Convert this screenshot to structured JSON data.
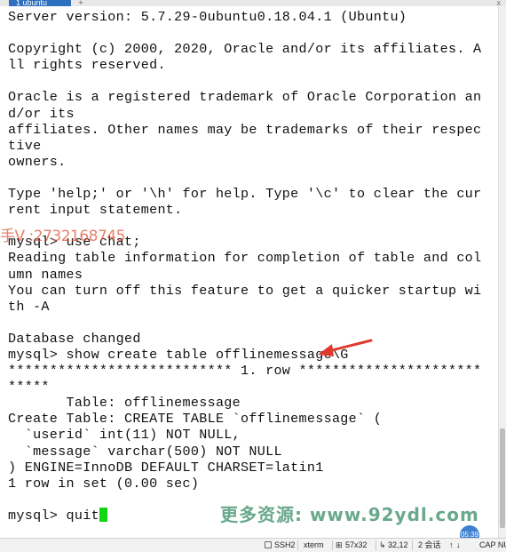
{
  "tab": {
    "title": "1 ubuntu",
    "add_label": "+",
    "close_label": "x"
  },
  "terminal": {
    "lines": [
      "Server version: 5.7.29-0ubuntu0.18.04.1 (Ubuntu)",
      "",
      "Copyright (c) 2000, 2020, Oracle and/or its affiliates. A",
      "ll rights reserved.",
      "",
      "Oracle is a registered trademark of Oracle Corporation an",
      "d/or its",
      "affiliates. Other names may be trademarks of their respec",
      "tive",
      "owners.",
      "",
      "Type 'help;' or '\\h' for help. Type '\\c' to clear the cur",
      "rent input statement.",
      "",
      "mysql> use chat;",
      "Reading table information for completion of table and col",
      "umn names",
      "You can turn off this feature to get a quicker startup wi",
      "th -A",
      "",
      "Database changed",
      "mysql> show create table offlinemessage\\G",
      "*************************** 1. row **********************",
      "*****",
      "       Table: offlinemessage",
      "Create Table: CREATE TABLE `offlinemessage` (",
      "  `userid` int(11) NOT NULL,",
      "  `message` varchar(500) NOT NULL",
      ") ENGINE=InnoDB DEFAULT CHARSET=latin1",
      "1 row in set (0.00 sec)",
      "",
      "mysql> quit"
    ]
  },
  "watermarks": {
    "contact": "手V :2732168745",
    "site": "更多资源: www.92ydl.com"
  },
  "timer": "05:39",
  "status": {
    "protocol": "SSH2",
    "terminal_type": "xterm",
    "size": "57x32",
    "cursor_pos": "32,12",
    "sessions": "2 会话",
    "caps": "CAP NU"
  },
  "colors": {
    "cursor": "#11d611",
    "tab": "#2f6fbf",
    "arrow": "#e03a2f"
  }
}
